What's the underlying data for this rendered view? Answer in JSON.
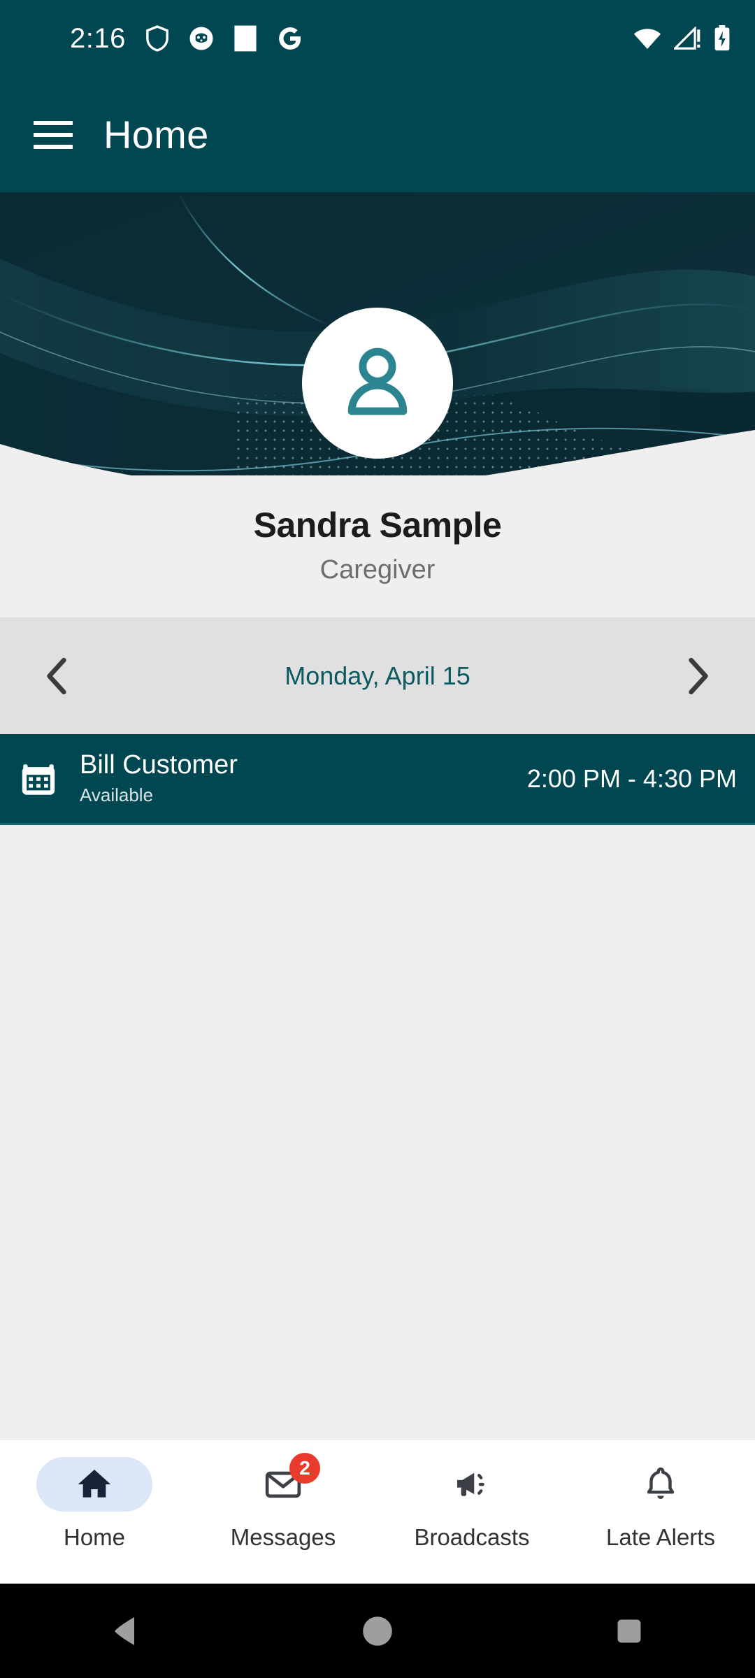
{
  "status_bar": {
    "time": "2:16",
    "left_icons": [
      "shield-icon",
      "app-circle-icon",
      "white-square-icon",
      "google-g-icon"
    ],
    "right_icons": [
      "wifi-icon",
      "cellular-no-signal-icon",
      "battery-charging-icon"
    ]
  },
  "app_bar": {
    "menu_icon": "hamburger-menu-icon",
    "title": "Home"
  },
  "hero": {
    "avatar_icon": "person-avatar-icon",
    "banner_style": "dark-teal-waves"
  },
  "profile": {
    "name": "Sandra Sample",
    "role": "Caregiver"
  },
  "date_nav": {
    "prev_icon": "chevron-left-icon",
    "next_icon": "chevron-right-icon",
    "current_date": "Monday, April 15"
  },
  "appointments": [
    {
      "icon": "calendar-icon",
      "client": "Bill Customer",
      "status": "Available",
      "time_range": "2:00 PM - 4:30 PM"
    }
  ],
  "bottom_nav": {
    "items": [
      {
        "label": "Home",
        "icon": "home-icon",
        "active": true,
        "badge": ""
      },
      {
        "label": "Messages",
        "icon": "envelope-icon",
        "active": false,
        "badge": "2"
      },
      {
        "label": "Broadcasts",
        "icon": "megaphone-icon",
        "active": false,
        "badge": ""
      },
      {
        "label": "Late Alerts",
        "icon": "bell-icon",
        "active": false,
        "badge": ""
      }
    ]
  },
  "android_nav": {
    "back_icon": "triangle-back-icon",
    "home_icon": "circle-home-icon",
    "recents_icon": "square-recents-icon"
  },
  "colors": {
    "primary_teal": "#014751",
    "accent_teal": "#0c5a60",
    "avatar_icon_teal": "#2b8490",
    "badge_red": "#e83b2c",
    "nav_active_pill": "#dbe6f7",
    "surface_gray": "#efefef",
    "datebar_gray": "#e0e0e0"
  }
}
